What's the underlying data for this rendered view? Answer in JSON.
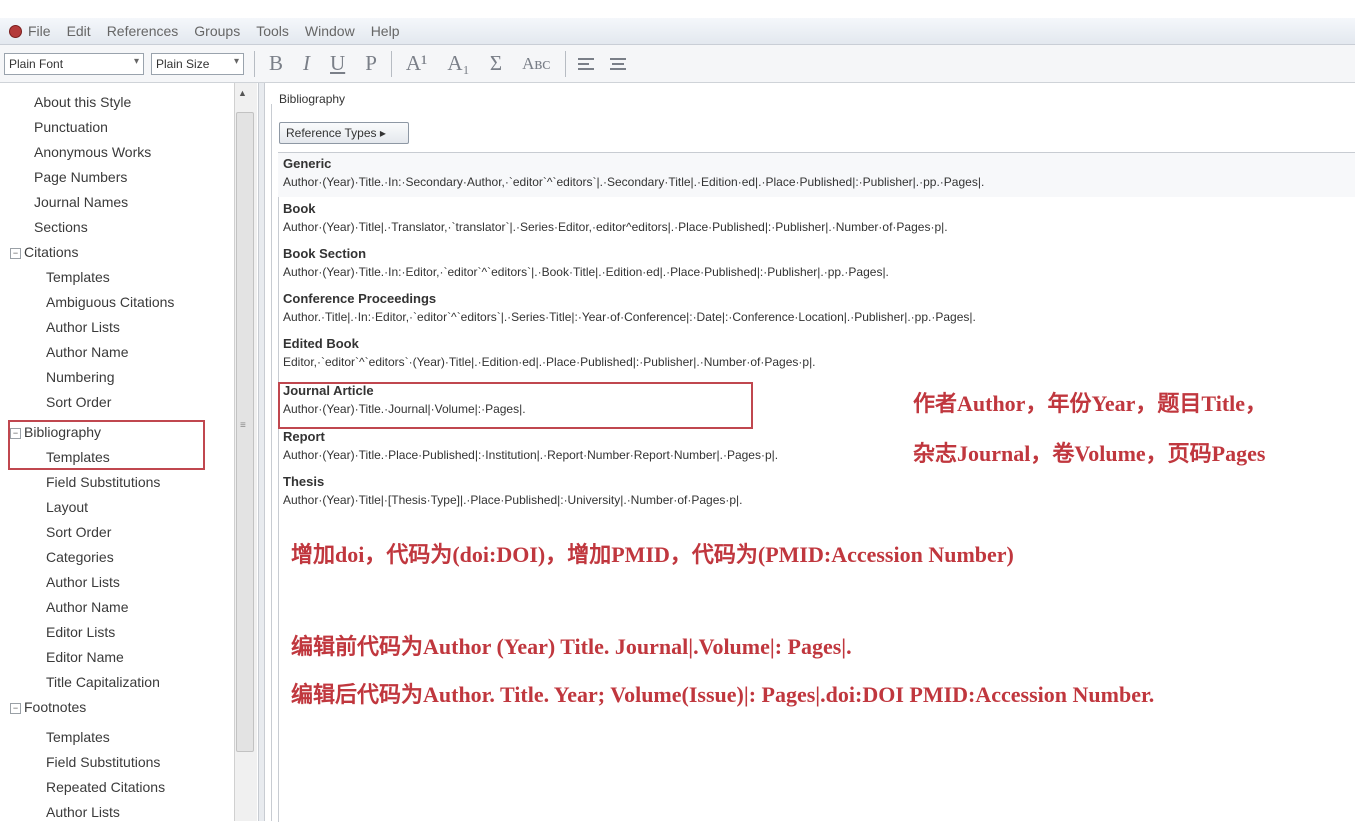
{
  "menubar": {
    "items": [
      "File",
      "Edit",
      "References",
      "Groups",
      "Tools",
      "Window",
      "Help"
    ]
  },
  "toolbar": {
    "font_value": "Plain Font",
    "size_value": "Plain Size",
    "bold": "B",
    "italic": "I",
    "underline": "U",
    "plain": "P",
    "superscript": "A¹",
    "subscript": "A₁",
    "symbol": "Σ",
    "small_caps": "Aʙᴄ"
  },
  "sidebar": {
    "items": [
      {
        "label": "About this Style"
      },
      {
        "label": "Punctuation"
      },
      {
        "label": "Anonymous Works"
      },
      {
        "label": "Page Numbers"
      },
      {
        "label": "Journal Names"
      },
      {
        "label": "Sections"
      },
      {
        "label": "Citations"
      },
      {
        "label": "Templates"
      },
      {
        "label": "Ambiguous Citations"
      },
      {
        "label": "Author Lists"
      },
      {
        "label": "Author Name"
      },
      {
        "label": "Numbering"
      },
      {
        "label": "Sort Order"
      },
      {
        "label": "Bibliography"
      },
      {
        "label": "Templates"
      },
      {
        "label": "Field Substitutions"
      },
      {
        "label": "Layout"
      },
      {
        "label": "Sort Order"
      },
      {
        "label": "Categories"
      },
      {
        "label": "Author Lists"
      },
      {
        "label": "Author Name"
      },
      {
        "label": "Editor Lists"
      },
      {
        "label": "Editor Name"
      },
      {
        "label": "Title Capitalization"
      },
      {
        "label": "Footnotes"
      },
      {
        "label": "Templates"
      },
      {
        "label": "Field Substitutions"
      },
      {
        "label": "Repeated Citations"
      },
      {
        "label": "Author Lists"
      }
    ]
  },
  "panel": {
    "title": "Bibliography",
    "ref_types_button": "Reference Types ▸"
  },
  "references": [
    {
      "type": "Generic",
      "template": "Author·(Year)·Title.·In:·Secondary·Author,·`editor`^`editors`|.·Secondary·Title|.·Edition·ed|.·Place·Published|:·Publisher|.·pp.·Pages|."
    },
    {
      "type": "Book",
      "template": "Author·(Year)·Title|.·Translator,·`translator`|.·Series·Editor,·editor^editors|.·Place·Published|:·Publisher|.·Number·of·Pages·p|."
    },
    {
      "type": "Book Section",
      "template": "Author·(Year)·Title.·In:·Editor,·`editor`^`editors`|.·Book·Title|.·Edition·ed|.·Place·Published|:·Publisher|.·pp.·Pages|."
    },
    {
      "type": "Conference Proceedings",
      "template": "Author.·Title|.·In:·Editor,·`editor`^`editors`|.·Series·Title|:·Year·of·Conference|:·Date|:·Conference·Location|.·Publisher|.·pp.·Pages|."
    },
    {
      "type": "Edited Book",
      "template": "Editor,·`editor`^`editors`·(Year)·Title|.·Edition·ed|.·Place·Published|:·Publisher|.·Number·of·Pages·p|."
    },
    {
      "type": "Journal Article",
      "template": "Author·(Year)·Title.·Journal|·Volume|:·Pages|."
    },
    {
      "type": "Report",
      "template": "Author·(Year)·Title.·Place·Published|:·Institution|.·Report·Number·Report·Number|.·Pages·p|."
    },
    {
      "type": "Thesis",
      "template": "Author·(Year)·Title|·[Thesis·Type]|.·Place·Published|:·University|.·Number·of·Pages·p|."
    }
  ],
  "annotations": {
    "line1": "作者Author，年份Year，题目Title，",
    "line2": "杂志Journal，卷Volume，页码Pages",
    "line3": "增加doi，代码为(doi:DOI)，增加PMID，代码为(PMID:Accession Number)",
    "line4": "编辑前代码为Author (Year) Title. Journal|.Volume|: Pages|.",
    "line5": "编辑后代码为Author. Title. Year; Volume(Issue)|: Pages|.doi:DOI PMID:Accession Number."
  },
  "colors": {
    "annotation_red": "#c0373e",
    "highlight_box": "#c0474f"
  }
}
